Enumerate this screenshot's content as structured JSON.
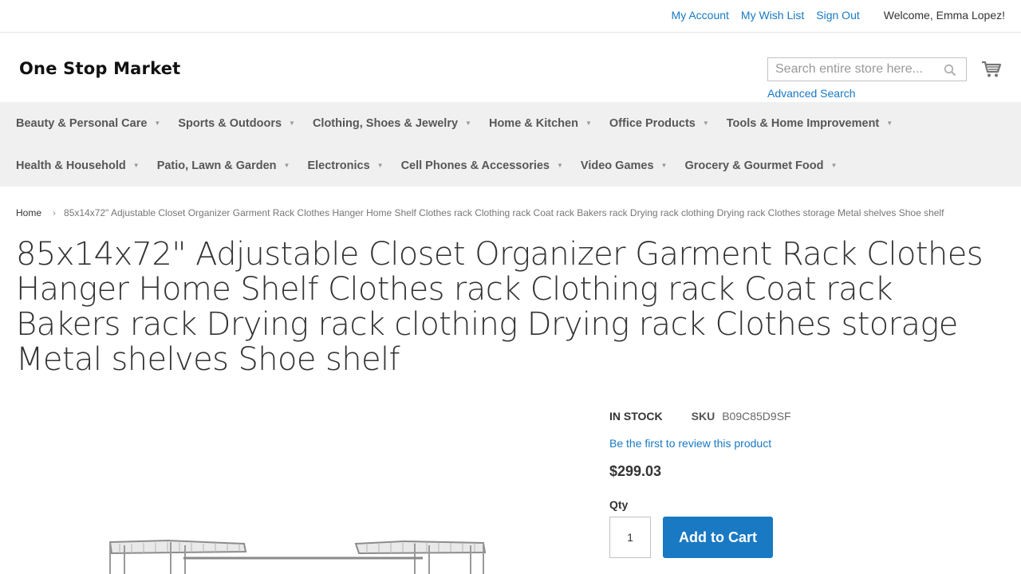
{
  "header": {
    "links": [
      "My Account",
      "My Wish List",
      "Sign Out"
    ],
    "welcome": "Welcome, Emma Lopez!"
  },
  "logo": {
    "text": "One Stop Market"
  },
  "search": {
    "placeholder": "Search entire store here...",
    "advanced": "Advanced Search"
  },
  "nav": {
    "row1": [
      "Beauty & Personal Care",
      "Sports & Outdoors",
      "Clothing, Shoes & Jewelry",
      "Home & Kitchen",
      "Office Products",
      "Tools & Home Improvement"
    ],
    "row2": [
      "Health & Household",
      "Patio, Lawn & Garden",
      "Electronics",
      "Cell Phones & Accessories",
      "Video Games",
      "Grocery & Gourmet Food"
    ]
  },
  "breadcrumb": {
    "home": "Home",
    "current": "85x14x72\" Adjustable Closet Organizer Garment Rack Clothes Hanger Home Shelf Clothes rack Clothing rack Coat rack Bakers rack Drying rack clothing Drying rack Clothes storage Metal shelves Shoe shelf"
  },
  "product": {
    "title": "85x14x72\" Adjustable Closet Organizer Garment Rack Clothes Hanger Home Shelf Clothes rack Clothing rack Coat rack Bakers rack Drying rack clothing Drying rack Clothes storage Metal shelves Shoe shelf",
    "stock": "IN STOCK",
    "sku_label": "SKU",
    "sku": "B09C85D9SF",
    "review_link": "Be the first to review this product",
    "price": "$299.03",
    "qty_label": "Qty",
    "qty_value": "1",
    "add_to_cart": "Add to Cart"
  },
  "colors": {
    "link": "#1979c3",
    "nav_bg": "#f0f0f0",
    "button": "#1979c3"
  }
}
